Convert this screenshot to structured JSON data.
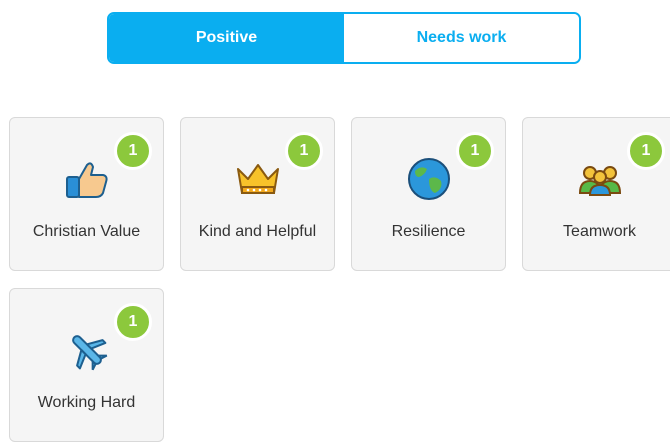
{
  "toggle": {
    "positive_label": "Positive",
    "needs_work_label": "Needs work"
  },
  "skills": [
    {
      "label": "Christian Value",
      "count": "1",
      "icon": "thumbs-up-icon"
    },
    {
      "label": "Kind and Helpful",
      "count": "1",
      "icon": "crown-icon"
    },
    {
      "label": "Resilience",
      "count": "1",
      "icon": "globe-icon"
    },
    {
      "label": "Teamwork",
      "count": "1",
      "icon": "team-icon"
    },
    {
      "label": "Working Hard",
      "count": "1",
      "icon": "airplane-icon"
    }
  ],
  "colors": {
    "accent": "#0aaef0",
    "badge": "#8cc83c"
  }
}
